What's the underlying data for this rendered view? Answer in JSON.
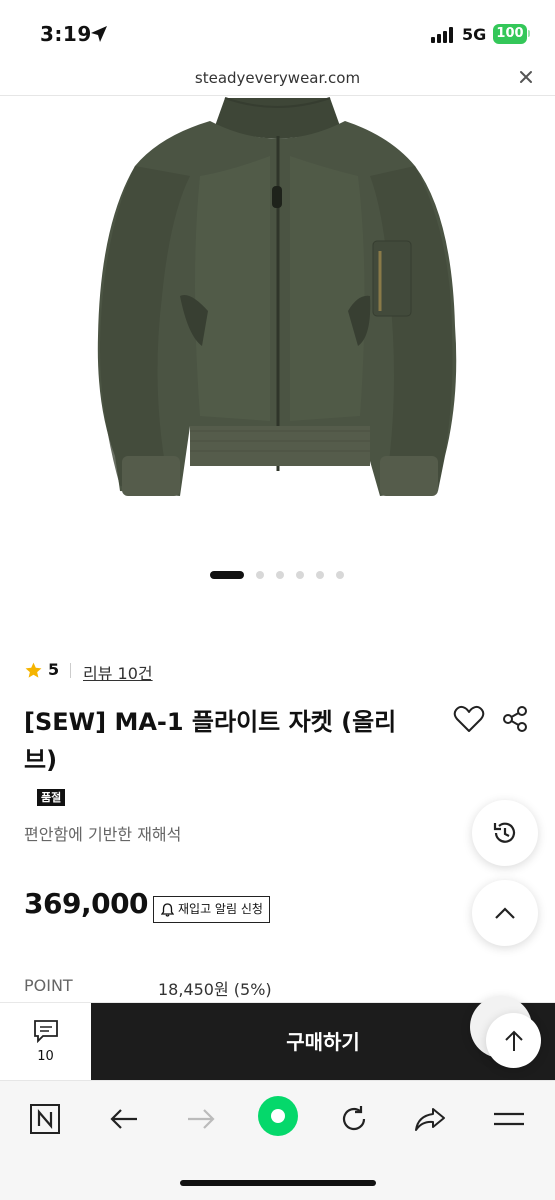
{
  "status_bar": {
    "time": "3:19",
    "network": "5G",
    "battery": "100"
  },
  "browser": {
    "url": "steadyeverywear.com"
  },
  "product": {
    "rating": "5",
    "reviews_label": "리뷰 10건",
    "title": "[SEW] MA-1 플라이트 자켓 (올리브)",
    "badge": "품절",
    "subtitle": "편안함에 기반한 재해석",
    "price": "369,000",
    "restock_label": "재입고 알림 신청",
    "point_label": "POINT",
    "point_value": "18,450원 (5%)"
  },
  "carousel": {
    "total": 6,
    "active": 0
  },
  "buy_bar": {
    "comment_count": "10",
    "buy_label": "구매하기"
  },
  "colors": {
    "accent_green": "#05d86b",
    "battery_green": "#34c759",
    "jacket_olive": "#4b5443"
  },
  "icons": [
    "location-arrow-icon",
    "signal-icon",
    "close-icon",
    "star-icon",
    "heart-icon",
    "share-icon",
    "bell-icon",
    "history-icon",
    "chevron-up-icon",
    "arrow-up-icon",
    "comment-icon",
    "naver-n-icon",
    "back-arrow-icon",
    "forward-arrow-icon",
    "green-dot-icon",
    "refresh-icon",
    "share-arrow-icon",
    "menu-icon"
  ]
}
